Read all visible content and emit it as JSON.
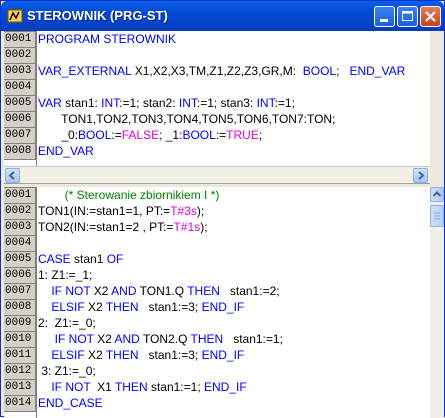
{
  "window": {
    "title": "STEROWNIK (PRG-ST)"
  },
  "icons": {
    "app": "plc-app-icon",
    "minimize": "minimize-icon",
    "maximize": "maximize-icon",
    "close": "close-icon"
  },
  "declarations": [
    {
      "num": "0001",
      "parts": [
        {
          "t": "PROGRAM STEROWNIK",
          "c": "kw"
        }
      ]
    },
    {
      "num": "0002",
      "parts": []
    },
    {
      "num": "0003",
      "parts": [
        {
          "t": "VAR_EXTERNAL",
          "c": "kw"
        },
        {
          "t": " X1,X2,X3,TM,Z1,Z2,Z3,GR,M:  "
        },
        {
          "t": "BOOL",
          "c": "kw"
        },
        {
          "t": ";   "
        },
        {
          "t": "END_VAR",
          "c": "kw"
        }
      ]
    },
    {
      "num": "0004",
      "parts": []
    },
    {
      "num": "0005",
      "parts": [
        {
          "t": "VAR",
          "c": "kw"
        },
        {
          "t": " stan1: "
        },
        {
          "t": "INT",
          "c": "kw"
        },
        {
          "t": ":=1; stan2: "
        },
        {
          "t": "INT",
          "c": "kw"
        },
        {
          "t": ":=1; stan3: "
        },
        {
          "t": "INT",
          "c": "kw"
        },
        {
          "t": ":=1;"
        }
      ]
    },
    {
      "num": "0006",
      "parts": [
        {
          "t": "       TON1,TON2,TON3,TON4,TON5,TON6,TON7:TON;"
        }
      ]
    },
    {
      "num": "0007",
      "parts": [
        {
          "t": "       _0:"
        },
        {
          "t": "BOOL",
          "c": "kw"
        },
        {
          "t": ":="
        },
        {
          "t": "FALSE",
          "c": "lit"
        },
        {
          "t": "; _1:"
        },
        {
          "t": "BOOL",
          "c": "kw"
        },
        {
          "t": ":="
        },
        {
          "t": "TRUE",
          "c": "lit"
        },
        {
          "t": ";"
        }
      ]
    },
    {
      "num": "0008",
      "parts": [
        {
          "t": "END_VAR",
          "c": "kw"
        }
      ]
    }
  ],
  "body": [
    {
      "num": "0001",
      "parts": [
        {
          "t": "        (* Sterowanie zbiornikiem I *)",
          "c": "cmt"
        }
      ]
    },
    {
      "num": "0002",
      "parts": [
        {
          "t": "TON1(IN:=stan1=1, PT:="
        },
        {
          "t": "T#3s",
          "c": "lit"
        },
        {
          "t": ");"
        }
      ]
    },
    {
      "num": "0003",
      "parts": [
        {
          "t": "TON2(IN:=stan1=2 , PT:="
        },
        {
          "t": "T#1s",
          "c": "lit"
        },
        {
          "t": ");"
        }
      ]
    },
    {
      "num": "0004",
      "parts": []
    },
    {
      "num": "0005",
      "parts": [
        {
          "t": "CASE",
          "c": "kw"
        },
        {
          "t": " stan1 "
        },
        {
          "t": "OF",
          "c": "kw"
        }
      ]
    },
    {
      "num": "0006",
      "parts": [
        {
          "t": "1: Z1:=_1;"
        }
      ]
    },
    {
      "num": "0007",
      "parts": [
        {
          "t": "    "
        },
        {
          "t": "IF NOT",
          "c": "kw"
        },
        {
          "t": " X2 "
        },
        {
          "t": "AND",
          "c": "kw"
        },
        {
          "t": " TON1.Q "
        },
        {
          "t": "THEN",
          "c": "kw"
        },
        {
          "t": "   stan1:=2;"
        }
      ]
    },
    {
      "num": "0008",
      "parts": [
        {
          "t": "    "
        },
        {
          "t": "ELSIF",
          "c": "kw"
        },
        {
          "t": " X2 "
        },
        {
          "t": "THEN",
          "c": "kw"
        },
        {
          "t": "   stan1:=3; "
        },
        {
          "t": "END_IF",
          "c": "kw"
        }
      ]
    },
    {
      "num": "0009",
      "parts": [
        {
          "t": "2:  Z1:=_0;"
        }
      ]
    },
    {
      "num": "0010",
      "parts": [
        {
          "t": "     "
        },
        {
          "t": "IF NOT",
          "c": "kw"
        },
        {
          "t": " X2 "
        },
        {
          "t": "AND",
          "c": "kw"
        },
        {
          "t": " TON2.Q "
        },
        {
          "t": "THEN",
          "c": "kw"
        },
        {
          "t": "   stan1:=1;"
        }
      ]
    },
    {
      "num": "0011",
      "parts": [
        {
          "t": "    "
        },
        {
          "t": "ELSIF",
          "c": "kw"
        },
        {
          "t": " X2 "
        },
        {
          "t": "THEN",
          "c": "kw"
        },
        {
          "t": "   stan1:=3; "
        },
        {
          "t": "END_IF",
          "c": "kw"
        }
      ]
    },
    {
      "num": "0012",
      "parts": [
        {
          "t": " 3: Z1:=_0;"
        }
      ]
    },
    {
      "num": "0013",
      "parts": [
        {
          "t": "    "
        },
        {
          "t": "IF NOT",
          "c": "kw"
        },
        {
          "t": "  X1 "
        },
        {
          "t": "THEN",
          "c": "kw"
        },
        {
          "t": " stan1:=1; "
        },
        {
          "t": "END_IF",
          "c": "kw"
        }
      ]
    },
    {
      "num": "0014",
      "parts": [
        {
          "t": "END_CASE",
          "c": "kw"
        }
      ]
    }
  ],
  "colors": {
    "keyword": "#0000ff",
    "literal": "#e000e0",
    "comment": "#008000",
    "title_bar": "#0449d3"
  }
}
